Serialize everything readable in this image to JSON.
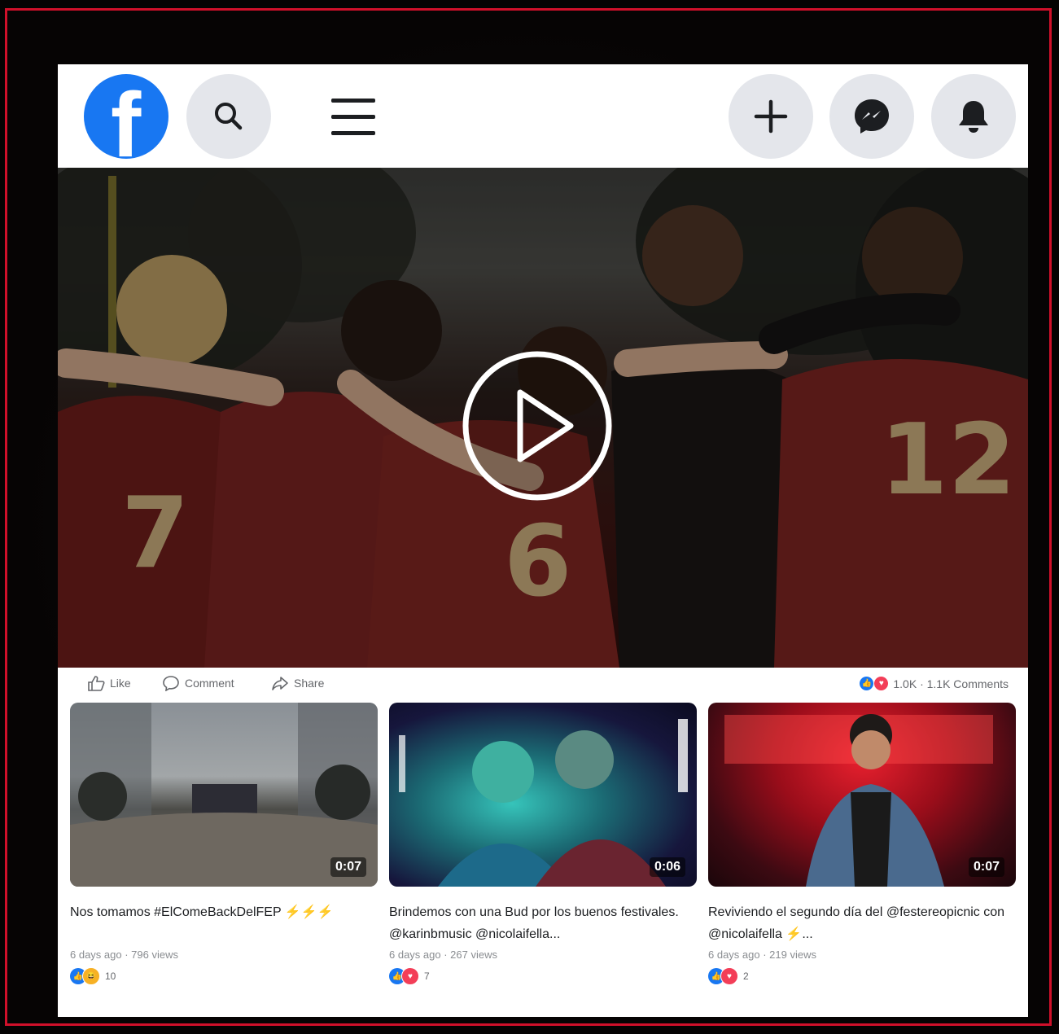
{
  "colors": {
    "frame_border": "#d0102a",
    "facebook_blue": "#1877f2",
    "button_gray": "#e4e6eb",
    "like_blue": "#1877f2",
    "love_red": "#f33e58",
    "haha_yellow": "#f7b125"
  },
  "topbar": {
    "logo_letter": "f",
    "icons": [
      "facebook-logo",
      "search-icon",
      "menu-icon",
      "plus-icon",
      "messenger-icon",
      "bell-icon"
    ]
  },
  "main_video": {
    "icon": "play-icon"
  },
  "actions": {
    "like_label": "Like",
    "comment_label": "Comment",
    "share_label": "Share",
    "stats_text": "1.0K · 1.1K Comments"
  },
  "videos": [
    {
      "duration": "0:07",
      "caption": "Nos tomamos #ElComeBackDelFEP ⚡⚡⚡",
      "meta": "6 days ago · 796 views",
      "reaction_count": "10",
      "reactions": [
        "like",
        "haha"
      ]
    },
    {
      "duration": "0:06",
      "caption": "Brindemos con una Bud por los buenos festivales. @karinbmusic @nicolaifella...",
      "meta": "6 days ago · 267 views",
      "reaction_count": "7",
      "reactions": [
        "like",
        "love"
      ]
    },
    {
      "duration": "0:07",
      "caption": "Reviviendo el segundo día del @festereopicnic con @nicolaifella ⚡...",
      "meta": "6 days ago · 219 views",
      "reaction_count": "2",
      "reactions": [
        "like",
        "love"
      ]
    }
  ]
}
